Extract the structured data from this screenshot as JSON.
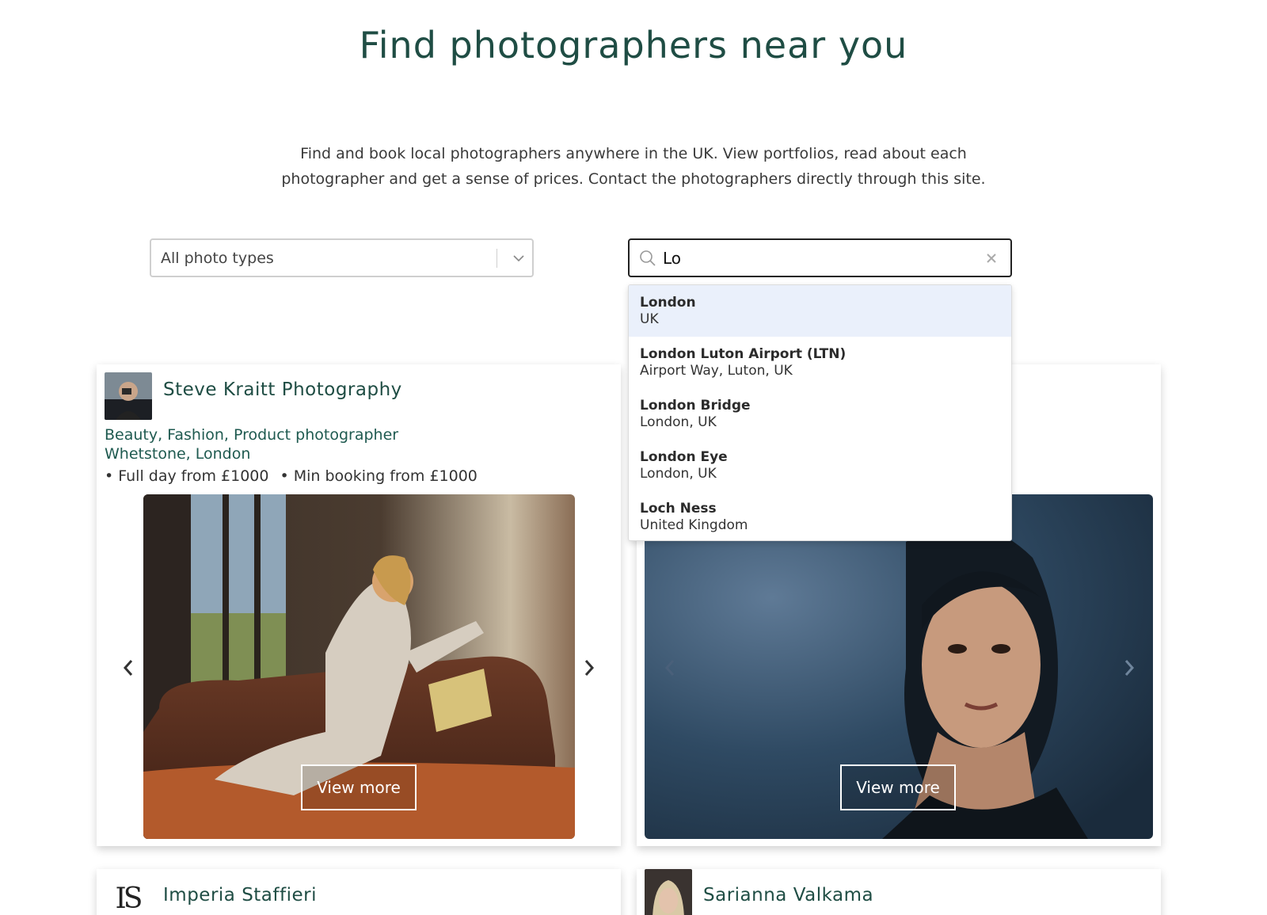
{
  "page": {
    "title": "Find photographers near you",
    "intro_line1": "Find and book local photographers anywhere in the UK. View portfolios, read about each",
    "intro_line2": "photographer and get a sense of prices. Contact the photographers directly through this site."
  },
  "filters": {
    "photo_type": {
      "value": "All photo types",
      "icon": "chevron-down-icon"
    },
    "location": {
      "value": "Lo",
      "search_icon": "search-icon",
      "clear_icon": "close-icon"
    }
  },
  "suggestions": [
    {
      "name": "London",
      "detail": "UK",
      "highlighted": true
    },
    {
      "name": "London Luton Airport (LTN)",
      "detail": "Airport Way, Luton, UK",
      "highlighted": false
    },
    {
      "name": "London Bridge",
      "detail": "London, UK",
      "highlighted": false
    },
    {
      "name": "London Eye",
      "detail": "London, UK",
      "highlighted": false
    },
    {
      "name": "Loch Ness",
      "detail": "United Kingdom",
      "highlighted": false
    }
  ],
  "photographers": [
    {
      "name": "Steve Kraitt Photography",
      "categories": "Beauty, Fashion, Product photographer",
      "location": "Whetstone, London",
      "price_full_day": "• Full day from £1000",
      "price_min": "• Min booking from £1000",
      "view_more": "View more"
    },
    {
      "view_more": "View more"
    },
    {
      "name": "Imperia Staffieri",
      "logo_text": "IS"
    },
    {
      "name": "Sarianna Valkama"
    }
  ],
  "colors": {
    "accent": "#1f4d44",
    "highlight": "#eaf0fb"
  }
}
